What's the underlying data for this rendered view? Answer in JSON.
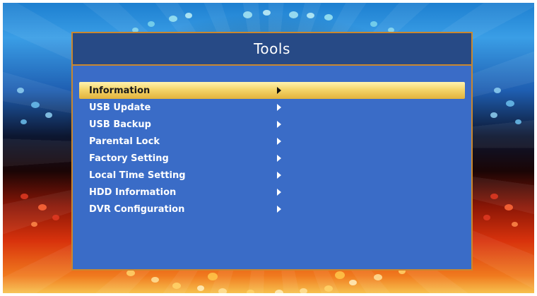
{
  "title": "Tools",
  "selected_index": 0,
  "menu": [
    {
      "label": "Information",
      "icon": "chevron-right-icon"
    },
    {
      "label": "USB Update",
      "icon": "chevron-right-icon"
    },
    {
      "label": "USB Backup",
      "icon": "chevron-right-icon"
    },
    {
      "label": "Parental Lock",
      "icon": "chevron-right-icon"
    },
    {
      "label": "Factory Setting",
      "icon": "chevron-right-icon"
    },
    {
      "label": "Local Time Setting",
      "icon": "chevron-right-icon"
    },
    {
      "label": "HDD Information",
      "icon": "chevron-right-icon"
    },
    {
      "label": "DVR Configuration",
      "icon": "chevron-right-icon"
    }
  ],
  "colors": {
    "panel_bg": "#3a6cc7",
    "title_bar": "#274a86",
    "border": "#c9872f",
    "highlight": "#f4d56a"
  }
}
